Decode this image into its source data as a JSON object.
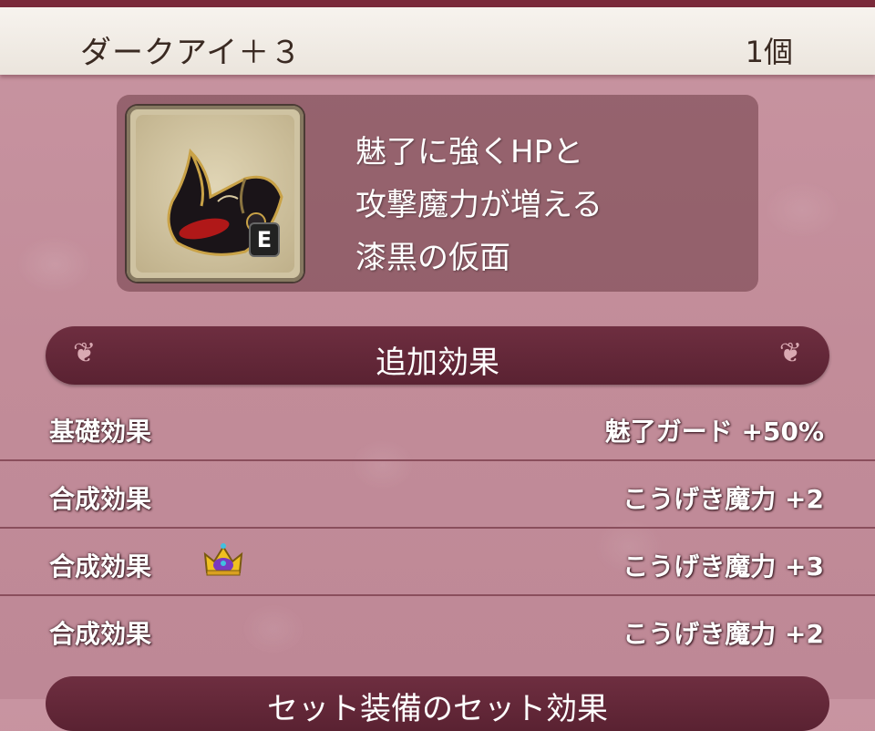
{
  "item": {
    "name": "ダークアイ＋３",
    "count": "1個",
    "icon": "dark-eye-mask-icon",
    "equipped_badge": "E",
    "description": [
      "魅了に強くHPと",
      "攻撃魔力が増える",
      "漆黒の仮面"
    ]
  },
  "section": {
    "title": "追加効果"
  },
  "effects": [
    {
      "label": "基礎効果",
      "value": "魅了ガード +50%",
      "icon": ""
    },
    {
      "label": "合成効果",
      "value": "こうげき魔力 +2",
      "icon": ""
    },
    {
      "label": "合成効果",
      "value": "こうげき魔力 +3",
      "icon": "crown-icon"
    },
    {
      "label": "合成効果",
      "value": "こうげき魔力 +2",
      "icon": ""
    }
  ],
  "next_section": {
    "title": "セット装備のセット効果"
  },
  "colors": {
    "background": "#c38e9b",
    "section_bar": "#6e2e40",
    "title_bar": "#f4efe8"
  }
}
